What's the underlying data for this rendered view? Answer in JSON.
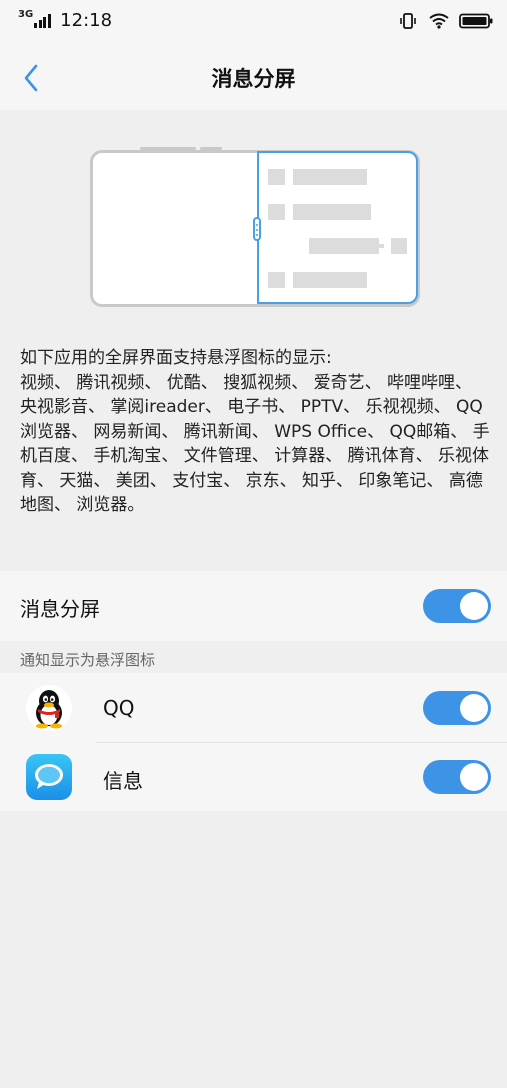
{
  "status_bar": {
    "network": "3G",
    "time": "12:18",
    "icons": [
      "signal-icon",
      "vibrate-icon",
      "wifi-icon",
      "battery-icon"
    ]
  },
  "nav": {
    "back_icon": "chevron-left-icon",
    "title": "消息分屏"
  },
  "description": {
    "intro": "如下应用的全屏界面支持悬浮图标的显示:",
    "apps_text": "视频、 腾讯视频、 优酷、 搜狐视频、 爱奇艺、 哔哩哔哩、 央视影音、 掌阅ireader、 电子书、 PPTV、 乐视视频、 QQ浏览器、 网易新闻、 腾讯新闻、 WPS Office、 QQ邮箱、 手机百度、 手机淘宝、 文件管理、 计算器、 腾讯体育、 乐视体育、 天猫、 美团、 支付宝、 京东、 知乎、 印象笔记、 高德地图、 浏览器。"
  },
  "main_setting": {
    "label": "消息分屏",
    "enabled": true
  },
  "section": {
    "label": "通知显示为悬浮图标"
  },
  "apps": [
    {
      "name": "QQ",
      "icon": "qq-penguin-icon",
      "enabled": true
    },
    {
      "name": "信息",
      "icon": "messages-bubble-icon",
      "enabled": true
    }
  ],
  "colors": {
    "accent": "#3d93e6",
    "background": "#efefef",
    "surface": "#f6f6f6"
  }
}
